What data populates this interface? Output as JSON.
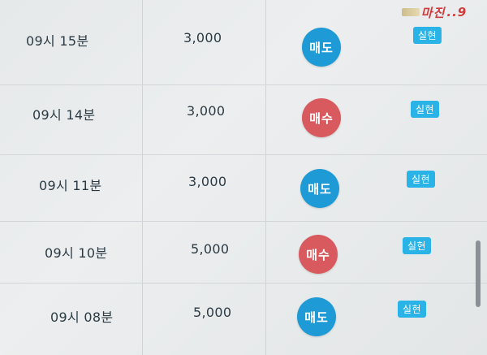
{
  "logo": {
    "text": "마진",
    "suffix": "..9"
  },
  "rows": [
    {
      "time": "09시 15분",
      "amount": "3,000",
      "action": "매도",
      "type": "sell",
      "status": "실현"
    },
    {
      "time": "09시 14분",
      "amount": "3,000",
      "action": "매수",
      "type": "buy",
      "status": "실현"
    },
    {
      "time": "09시 11분",
      "amount": "3,000",
      "action": "매도",
      "type": "sell",
      "status": "실현"
    },
    {
      "time": "09시 10분",
      "amount": "5,000",
      "action": "매수",
      "type": "buy",
      "status": "실현"
    },
    {
      "time": "09시 08분",
      "amount": "5,000",
      "action": "매도",
      "type": "sell",
      "status": "실현"
    }
  ],
  "colors": {
    "sell": "#1e9bd6",
    "buy": "#d85a5e",
    "tag": "#2ab3e6",
    "text": "#2c3a44"
  }
}
